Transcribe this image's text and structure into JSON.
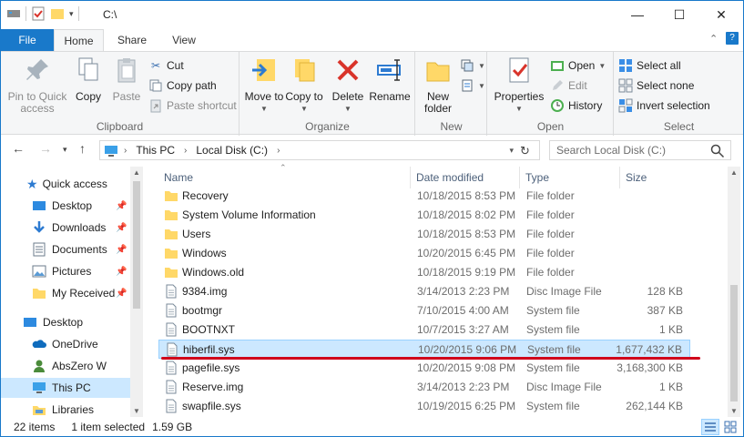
{
  "window": {
    "title": "C:\\"
  },
  "window_controls": {
    "minimize": "—",
    "maximize": "☐",
    "close": "✕"
  },
  "ribbon_tabs": [
    {
      "label": "File"
    },
    {
      "label": "Home"
    },
    {
      "label": "Share"
    },
    {
      "label": "View"
    }
  ],
  "ribbon_right": {
    "collapse": "⌃",
    "help": "?"
  },
  "ribbon": {
    "clipboard": {
      "label": "Clipboard",
      "pin": "Pin to Quick access",
      "copy": "Copy",
      "paste": "Paste",
      "cut": "Cut",
      "copy_path": "Copy path",
      "paste_shortcut": "Paste shortcut"
    },
    "organize": {
      "label": "Organize",
      "move_to": "Move to",
      "copy_to": "Copy to",
      "delete": "Delete",
      "rename": "Rename"
    },
    "new": {
      "label": "New",
      "new_folder": "New folder"
    },
    "open": {
      "label": "Open",
      "properties": "Properties",
      "open": "Open",
      "edit": "Edit",
      "history": "History"
    },
    "select": {
      "label": "Select",
      "select_all": "Select all",
      "select_none": "Select none",
      "invert": "Invert selection"
    }
  },
  "address": {
    "crumbs": [
      "This PC",
      "Local Disk (C:)"
    ],
    "search_placeholder": "Search Local Disk (C:)"
  },
  "nav_pane": {
    "quick_access": "Quick access",
    "quick_items": [
      "Desktop",
      "Downloads",
      "Documents",
      "Pictures",
      "My Received"
    ],
    "other_items": [
      "Desktop",
      "OneDrive",
      "AbsZero W",
      "This PC",
      "Libraries"
    ]
  },
  "columns": {
    "name": "Name",
    "date": "Date modified",
    "type": "Type",
    "size": "Size"
  },
  "files": [
    {
      "name": "Recovery",
      "date": "10/18/2015 8:53 PM",
      "type": "File folder",
      "size": "",
      "icon": "folder-icon"
    },
    {
      "name": "System Volume Information",
      "date": "10/18/2015 8:02 PM",
      "type": "File folder",
      "size": "",
      "icon": "folder-icon"
    },
    {
      "name": "Users",
      "date": "10/18/2015 8:53 PM",
      "type": "File folder",
      "size": "",
      "icon": "folder-icon"
    },
    {
      "name": "Windows",
      "date": "10/20/2015 6:45 PM",
      "type": "File folder",
      "size": "",
      "icon": "folder-icon"
    },
    {
      "name": "Windows.old",
      "date": "10/18/2015 9:19 PM",
      "type": "File folder",
      "size": "",
      "icon": "folder-icon"
    },
    {
      "name": "9384.img",
      "date": "3/14/2013 2:23 PM",
      "type": "Disc Image File",
      "size": "128 KB",
      "icon": "file-icon"
    },
    {
      "name": "bootmgr",
      "date": "7/10/2015 4:00 AM",
      "type": "System file",
      "size": "387 KB",
      "icon": "file-icon"
    },
    {
      "name": "BOOTNXT",
      "date": "10/7/2015 3:27 AM",
      "type": "System file",
      "size": "1 KB",
      "icon": "file-icon"
    },
    {
      "name": "hiberfil.sys",
      "date": "10/20/2015 9:06 PM",
      "type": "System file",
      "size": "1,677,432 KB",
      "icon": "file-icon",
      "selected": true
    },
    {
      "name": "pagefile.sys",
      "date": "10/20/2015 9:08 PM",
      "type": "System file",
      "size": "3,168,300 KB",
      "icon": "file-icon"
    },
    {
      "name": "Reserve.img",
      "date": "3/14/2013 2:23 PM",
      "type": "Disc Image File",
      "size": "1 KB",
      "icon": "file-icon"
    },
    {
      "name": "swapfile.sys",
      "date": "10/19/2015 6:25 PM",
      "type": "System file",
      "size": "262,144 KB",
      "icon": "file-icon"
    }
  ],
  "status": {
    "items": "22 items",
    "selected": "1 item selected",
    "size": "1.59 GB"
  },
  "colors": {
    "accent": "#1979ca",
    "selection": "#cce8ff",
    "underline": "#d0021b",
    "folder": "#ffd868"
  }
}
